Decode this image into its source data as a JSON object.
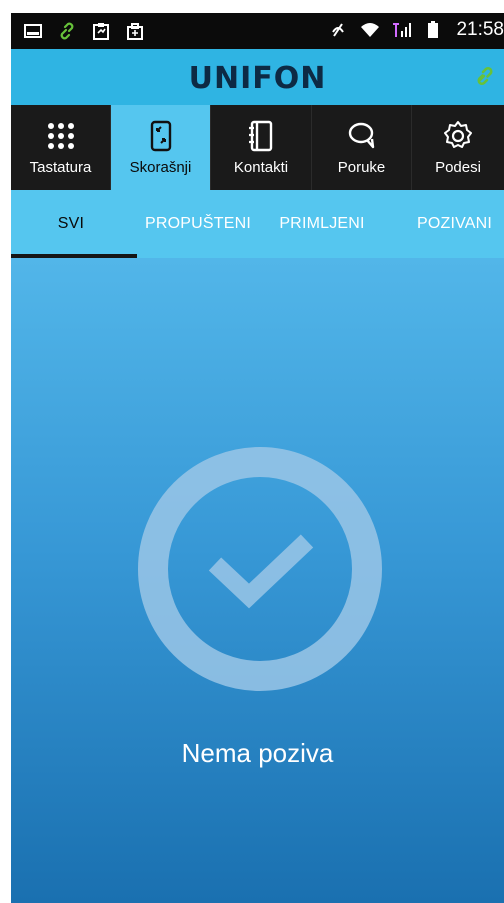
{
  "statusbar": {
    "time": "21:58",
    "icons": [
      "image-icon",
      "link-icon",
      "clipboard-icon",
      "briefcase-icon",
      "mute-icon",
      "wifi-icon",
      "signal-icon",
      "battery-icon"
    ]
  },
  "header": {
    "logo": "UNIFON",
    "link_icon": "link-icon"
  },
  "nav": {
    "items": [
      {
        "label": "Tastatura",
        "icon": "keypad-icon"
      },
      {
        "label": "Skorašnji",
        "icon": "recent-calls-icon"
      },
      {
        "label": "Kontakti",
        "icon": "contacts-book-icon"
      },
      {
        "label": "Poruke",
        "icon": "chat-bubble-icon"
      },
      {
        "label": "Podesi",
        "icon": "gear-icon"
      }
    ],
    "active_index": 1
  },
  "tabs": {
    "items": [
      "SVI",
      "PROPUŠTENI",
      "PRIMLJENI",
      "POZIVANI"
    ],
    "active_index": 0
  },
  "empty_state": {
    "icon": "check-circle-icon",
    "text": "Nema poziva"
  },
  "colors": {
    "statusbar": "#0b0b0b",
    "header": "#2fb4e3",
    "nav_bg": "#1a1a1a",
    "nav_active": "#55c6ef",
    "tabs_bg": "#55c6ef",
    "content_top": "#52b6e9",
    "content_bottom": "#1a70b0"
  }
}
